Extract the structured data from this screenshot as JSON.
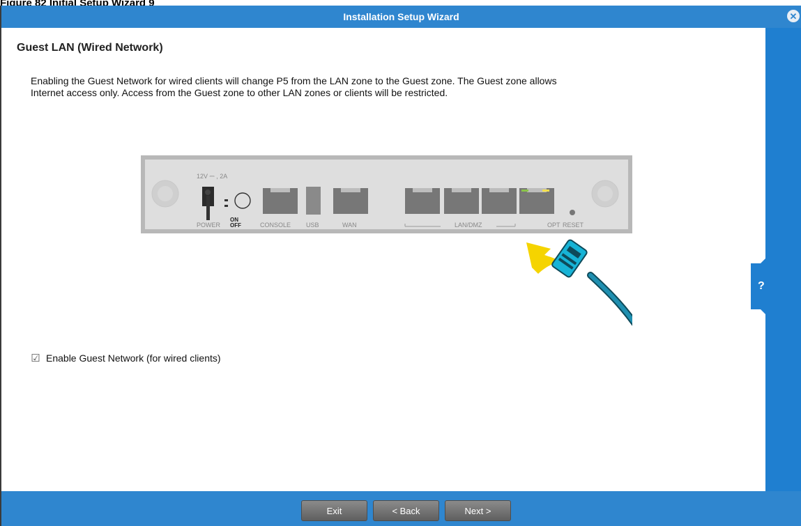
{
  "caption": "Figure 82   Initial Setup Wizard 9",
  "window": {
    "title": "Installation Setup Wizard"
  },
  "icons": {
    "close": "close-circle-icon",
    "help": "question-icon",
    "check": "checkmark-icon"
  },
  "help_tab": {
    "label": "?"
  },
  "content": {
    "heading": "Guest LAN (Wired Network)",
    "description_line1": "Enabling the Guest Network for wired clients will change P5 from the LAN zone to the Guest zone. The Guest zone allows",
    "description_line2": "Internet access only. Access from the Guest zone to other LAN zones or clients will be restricted."
  },
  "device": {
    "rating": "12V ⎓ , 2A",
    "labels": {
      "power": "POWER",
      "on": "ON",
      "off": "OFF",
      "console": "CONSOLE",
      "usb": "USB",
      "wan": "WAN",
      "lan_dmz": "LAN/DMZ",
      "opt": "OPT",
      "reset": "RESET"
    }
  },
  "checkbox": {
    "label": "Enable Guest Network (for wired clients)",
    "checked": true
  },
  "footer": {
    "exit": "Exit",
    "back": "< Back",
    "next": "Next >"
  },
  "colors": {
    "primary": "#2f86cf",
    "rail": "#1f7fd0",
    "button": "#6e6e6e",
    "arrow": "#f5d400",
    "cable": "#1f6f88"
  }
}
